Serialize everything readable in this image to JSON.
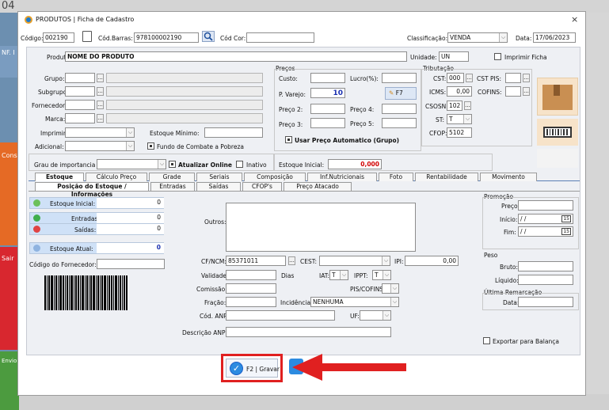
{
  "background": {
    "corner_number": "04",
    "side_labels": {
      "nf": "NF. I",
      "cons": "Cons",
      "sair": "Sair",
      "envio": "Envio"
    }
  },
  "window": {
    "title": "PRODUTOS | Ficha de Cadastro",
    "close": "×"
  },
  "header": {
    "codigo_label": "Código:",
    "codigo_value": "002190",
    "barras_label": "Cód.Barras:",
    "barras_value": "978100002190",
    "codcor_label": "Cód Cor:",
    "classificacao_label": "Classificação:",
    "classificacao_value": "VENDA",
    "data_label": "Data:",
    "data_value": "17/06/2023"
  },
  "product": {
    "produto_label": "Produto:",
    "produto_value": "NOME DO PRODUTO",
    "unidade_label": "Unidade:",
    "unidade_value": "UN",
    "imprimir_ficha": "Imprimir Ficha"
  },
  "left_fields": {
    "grupo": "Grupo:",
    "subgrupo": "Subgrupo:",
    "fornecedor": "Fornecedor:",
    "marca": "Marca:",
    "imprimir": "Imprimir:",
    "estoque_minimo": "Estoque Mínimo:",
    "adicional": "Adicional:",
    "fundo_combate": "Fundo de Combate a Pobreza",
    "grau_importancia": "Grau de importancia",
    "atualizar_online": "Atualizar Online",
    "inativo": "Inativo"
  },
  "precos": {
    "title": "Preços",
    "custo": "Custo:",
    "lucro": "Lucro(%):",
    "p_varejo": "P. Varejo:",
    "p_varejo_value": "10",
    "f7": "F7",
    "preco2": "Preço 2:",
    "preco3": "Preço 3:",
    "preco4": "Preço 4:",
    "preco5": "Preço 5:",
    "usar_automatico": "Usar Preço Automatico (Grupo)",
    "estoque_inicial": "Estoque Inicial:",
    "estoque_inicial_value": "0,000"
  },
  "tributacao": {
    "title": "Tributação",
    "cst": "CST:",
    "cst_value": "000",
    "cst_pis": "CST PIS:",
    "icms": "ICMS:",
    "icms_value": "0,00",
    "cofins": "COFINS:",
    "csosn": "CSOSN:",
    "csosn_value": "102",
    "st": "ST:",
    "st_value": "T",
    "cfop": "CFOP:",
    "cfop_value": "5102"
  },
  "tabs_row1": [
    "Estoque",
    "Cálculo Preço",
    "Grade",
    "Seriais",
    "Composição",
    "Inf.Nutricionais",
    "Foto",
    "Rentabilidade",
    "Movimento"
  ],
  "tabs_row2": [
    "Posição do Estoque / Informações",
    "Entradas",
    "Saídas",
    "CFOP's",
    "Preço Atacado"
  ],
  "stock": {
    "inicial_label": "Estoque Inicial:",
    "inicial_value": "0",
    "entradas_label": "Entradas:",
    "entradas_value": "0",
    "saidas_label": "Saídas:",
    "saidas_value": "0",
    "atual_label": "Estoque Atual:",
    "atual_value": "0",
    "cod_fornecedor": "Código do Fornecedor:"
  },
  "info": {
    "outros": "Outros:",
    "cfncm": "CF/NCM:",
    "cfncm_value": "85371011",
    "cest": "CEST:",
    "ipi": "IPI:",
    "ipi_value": "0,00",
    "validade": "Validade:",
    "dias": "Dias",
    "iat": "IAT:",
    "iat_value": "T",
    "ippt": "IPPT:",
    "ippt_value": "T",
    "comissao": "Comissão:",
    "pis_cofins": "PIS/COFINS:",
    "fracao": "Fração:",
    "incidencia": "Incidência:",
    "incidencia_value": "NENHUMA",
    "cod_anp": "Cód. ANP:",
    "uf": "UF:",
    "descricao_anp": "Descrição ANP:"
  },
  "right_panel": {
    "promocao": "Promoção",
    "preco": "Preço:",
    "inicio": "Início:",
    "fim": "Fim:",
    "date_placeholder": "/ /",
    "cal": "15",
    "peso": "Peso",
    "bruto": "Bruto:",
    "liquido": "Líquido:",
    "ultima_remarcacao": "Última Remarcação",
    "data": "Data:",
    "exportar_balanca": "Exportar para Balança"
  },
  "footer": {
    "gravar": "F2 | Gravar"
  },
  "colors": {
    "accent": "#1a5fc9",
    "highlight": "#e02020",
    "tab_border": "#5b7fb5"
  }
}
